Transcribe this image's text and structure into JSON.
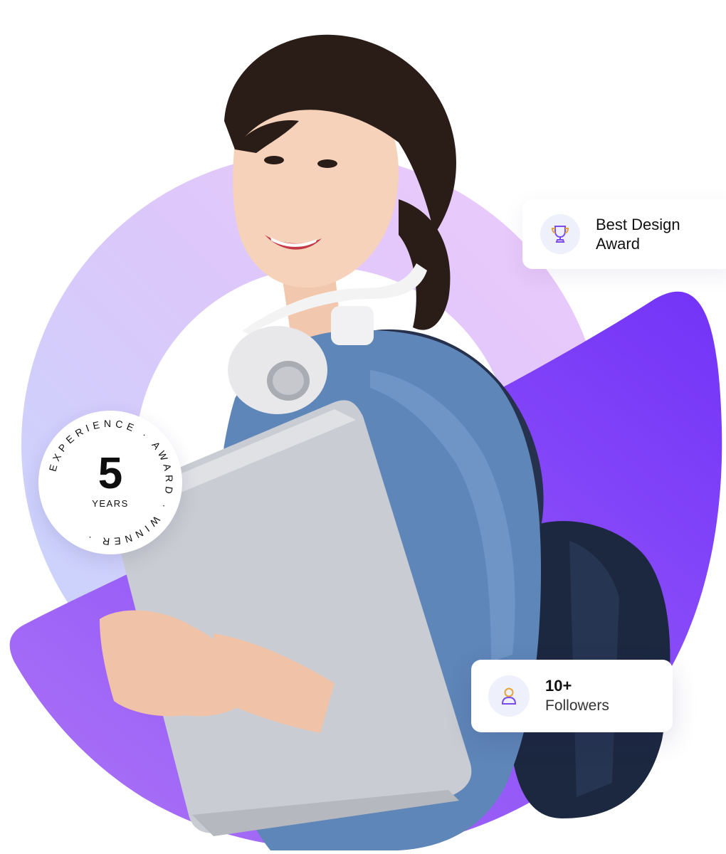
{
  "award": {
    "icon": "trophy-icon",
    "line1": "Best Design",
    "line2": "Award"
  },
  "followers": {
    "icon": "user-icon",
    "count": "10+",
    "caption": "Followers"
  },
  "badge": {
    "number": "5",
    "unit": "YEARS",
    "ring_text": "EXPERIENCE · AWARD · WINNER ·"
  },
  "colors": {
    "purple_accent": "#7b3cf6",
    "lavender": "#e6c9fb",
    "light_blue": "#c7d6fc",
    "denim": "#5f86b8",
    "trophy": "#7a4cf0",
    "trophy_base": "#e5a43a"
  }
}
